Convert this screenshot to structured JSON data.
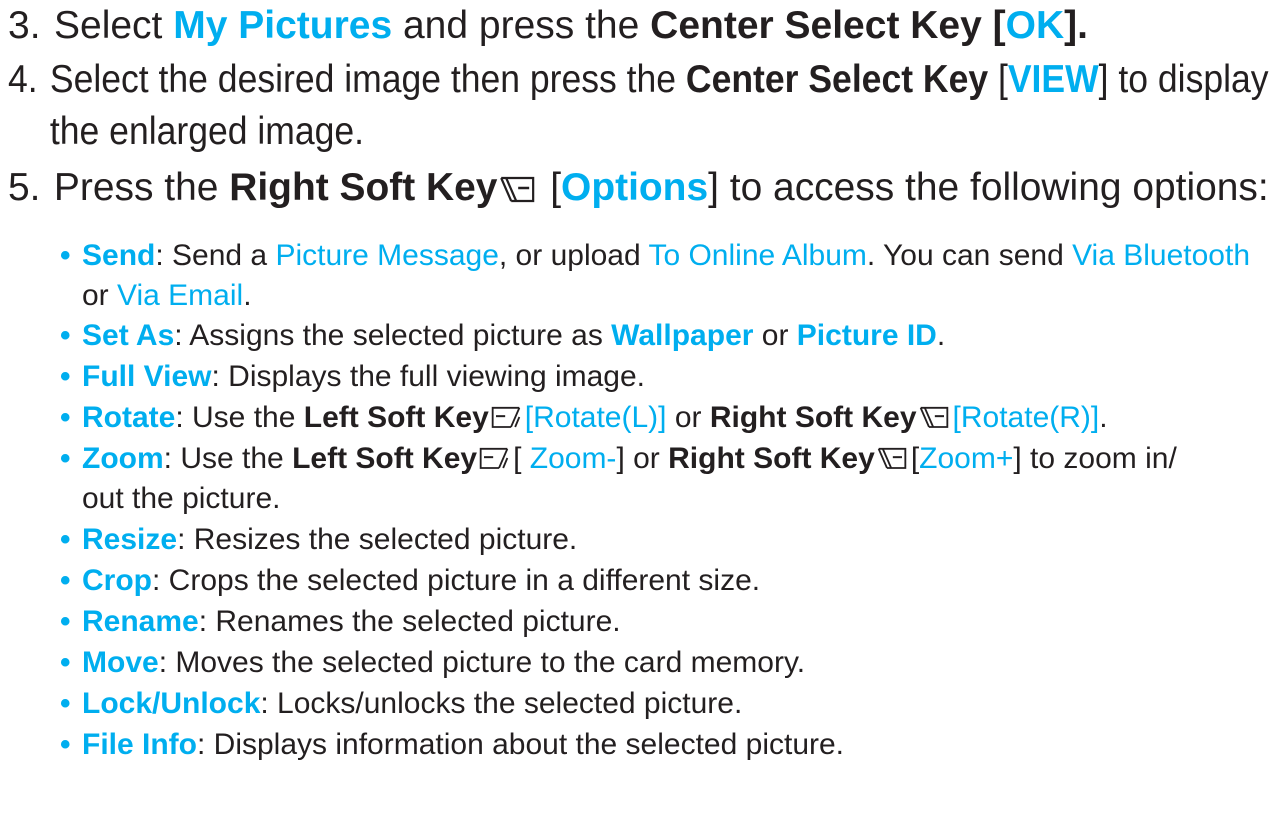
{
  "steps": [
    {
      "num": "3.",
      "t1": "Select ",
      "menu": "My Pictures",
      "t2": " and press the ",
      "key": "Center Select Key",
      "lb": " [",
      "softlabel": "OK",
      "rb": "]."
    },
    {
      "num": "4.",
      "t1": "Select the desired image then press the ",
      "key": "Center Select Key",
      "lb": " [",
      "softlabel": "VIEW",
      "rb": "] to display",
      "line2": "the enlarged image."
    },
    {
      "num": "5.",
      "t1": "Press the ",
      "key": "Right Soft Key",
      "key_icon": "right-soft-key-icon",
      "lb": " [",
      "softlabel": "Options",
      "rb": "] to access the following options:"
    }
  ],
  "bullet_glyph": "•",
  "options": {
    "send": {
      "name": "Send",
      "t1": ": Send a ",
      "l1": "Picture Message",
      "t2": ", or upload ",
      "l2": "To Online Album",
      "t3": ". You can send ",
      "l3": "Via Bluetooth",
      "t4": "or ",
      "l4": "Via Email",
      "t5": "."
    },
    "set_as": {
      "name": "Set As",
      "t1": ": Assigns the selected picture as ",
      "l1": "Wallpaper",
      "t2": " or ",
      "l2": "Picture ID",
      "t3": "."
    },
    "full_view": {
      "name": "Full View",
      "t1": ": Displays the full viewing image."
    },
    "rotate": {
      "name": "Rotate",
      "t1": ": Use the ",
      "k1": "Left Soft Key",
      "k1_icon": "left-soft-key-icon",
      "l1": "[Rotate(L)]",
      "t2": " or ",
      "k2": "Right Soft Key",
      "k2_icon": "right-soft-key-icon",
      "l2": "[Rotate(R)]",
      "t3": "."
    },
    "zoom": {
      "name": "Zoom",
      "t1": ": Use the ",
      "k1": "Left Soft Key",
      "k1_icon": "left-soft-key-icon",
      "lb1": "[ ",
      "l1": "Zoom-",
      "rb1": "]",
      "t2": " or ",
      "k2": "Right Soft Key",
      "k2_icon": "right-soft-key-icon",
      "lb2": "[",
      "l2": "Zoom+",
      "rb2": "] to zoom in/",
      "line2": "out the picture."
    },
    "resize": {
      "name": "Resize",
      "t1": ": Resizes the selected picture."
    },
    "crop": {
      "name": "Crop",
      "t1": ": Crops the selected picture in a different size."
    },
    "rename": {
      "name": "Rename",
      "t1": ": Renames the selected picture."
    },
    "move": {
      "name": "Move",
      "t1": ": Moves the selected picture to the card memory."
    },
    "lock": {
      "name": "Lock/Unlock",
      "t1": ": Locks/unlocks the selected picture."
    },
    "file_info": {
      "name": "File Info",
      "t1": ": Displays information about the selected picture."
    }
  },
  "colors": {
    "accent": "#00aeef",
    "text": "#231f20"
  }
}
